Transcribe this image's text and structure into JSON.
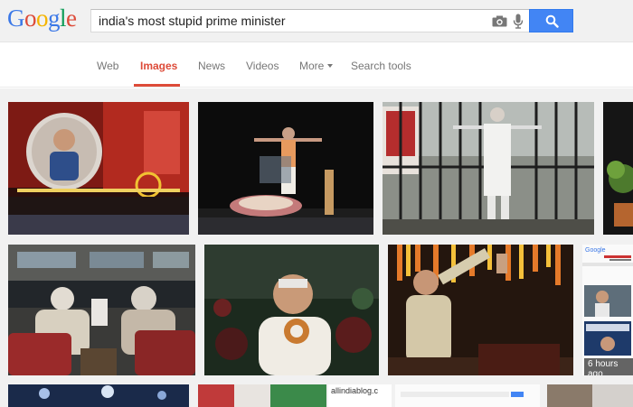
{
  "logo": {
    "letters": [
      "G",
      "o",
      "o",
      "g",
      "l",
      "e"
    ],
    "colors": [
      "#3b78e7",
      "#dd4b39",
      "#f4b400",
      "#3b78e7",
      "#0f9d58",
      "#dd4b39"
    ]
  },
  "search": {
    "query": "india's most stupid prime minister",
    "button_icon": "magnifier-icon",
    "accent": "#4285f4"
  },
  "tabs": [
    {
      "label": "Web",
      "active": false
    },
    {
      "label": "Images",
      "active": true
    },
    {
      "label": "News",
      "active": false
    },
    {
      "label": "Videos",
      "active": false
    },
    {
      "label": "More",
      "active": false
    },
    {
      "label": "Search tools",
      "active": false
    }
  ],
  "results": {
    "side_caption": "allindiablog.c",
    "thumb_badge": "6 hours ago",
    "side_logo": "Google"
  }
}
